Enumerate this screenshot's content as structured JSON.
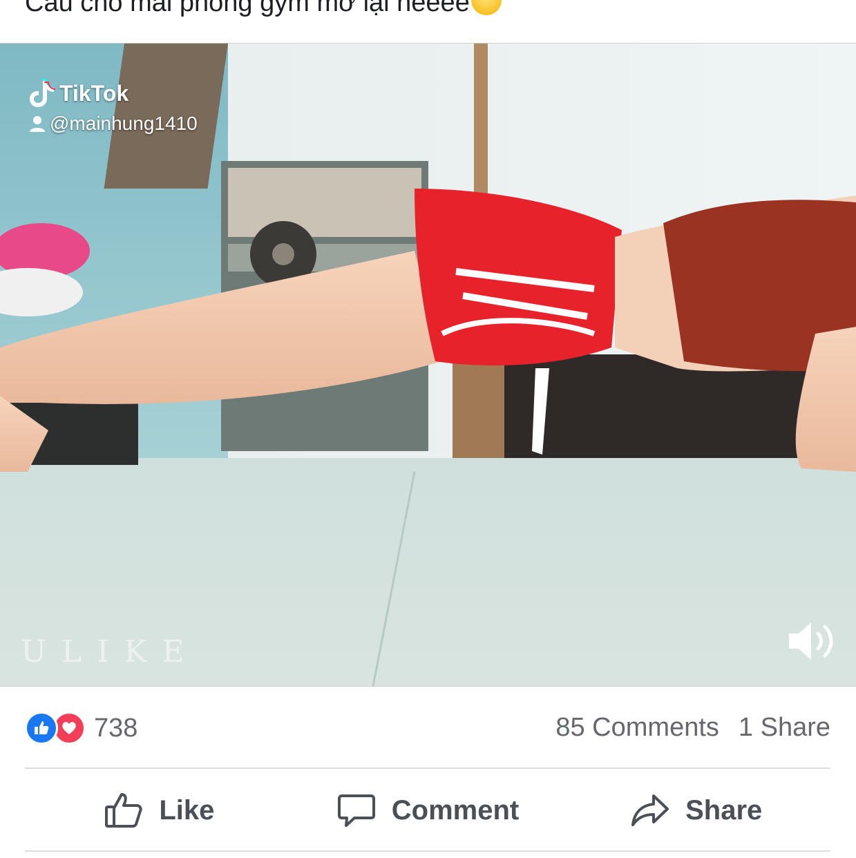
{
  "post": {
    "caption": "Cầu cho mai phòng gym mở lại neeee"
  },
  "video": {
    "tiktok_brand": "TikTok",
    "tiktok_user": "@mainhung1410",
    "watermark": "ULIKE",
    "volume_icon": "speaker-volume-icon"
  },
  "stats": {
    "reaction_count": "738",
    "reaction_icons": [
      "like-reaction-icon",
      "love-reaction-icon"
    ],
    "comments": "85 Comments",
    "shares": "1 Share"
  },
  "actions": {
    "like_label": "Like",
    "comment_label": "Comment",
    "share_label": "Share"
  },
  "colors": {
    "like_blue": "#1877f2",
    "love_red": "#f33e58",
    "text_secondary": "#65676b",
    "action_text": "#4b4f56",
    "divider": "#dadde1"
  }
}
